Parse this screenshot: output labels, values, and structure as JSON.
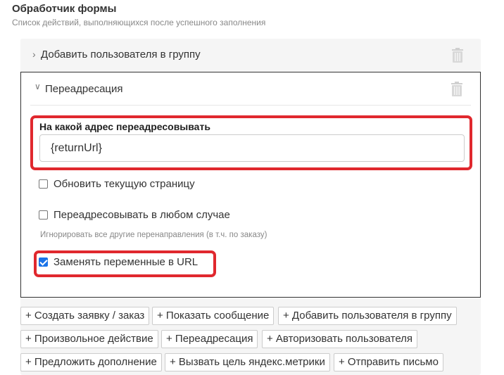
{
  "header": {
    "title": "Обработчик формы",
    "subtitle": "Список действий, выполняющихся после успешного заполнения"
  },
  "actions": [
    {
      "label": "Добавить пользователя в группу",
      "expanded": false,
      "icon": "chevron-right-icon"
    },
    {
      "label": "Переадресация",
      "expanded": true,
      "icon": "chevron-down-icon"
    }
  ],
  "redirect": {
    "address_label": "На какой адрес переадресовывать",
    "address_value": "{returnUrl}",
    "refresh_label": "Обновить текущую страницу",
    "refresh_checked": false,
    "always_label": "Переадресовывать в любом случае",
    "always_checked": false,
    "always_hint": "Игнорировать все другие перенаправления (в т.ч. по заказу)",
    "replace_vars_label": "Заменять переменные в URL",
    "replace_vars_checked": true
  },
  "add_buttons": [
    "+ Создать заявку / заказ",
    "+ Показать сообщение",
    "+ Добавить пользователя в группу",
    "+ Произвольное действие",
    "+ Переадресация",
    "+ Авторизовать пользователя",
    "+ Предложить дополнение",
    "+ Вызвать цель яндекс.метрики",
    "+ Отправить письмо"
  ],
  "colors": {
    "highlight": "#e0282e",
    "checkbox_accent": "#1a73e8"
  }
}
